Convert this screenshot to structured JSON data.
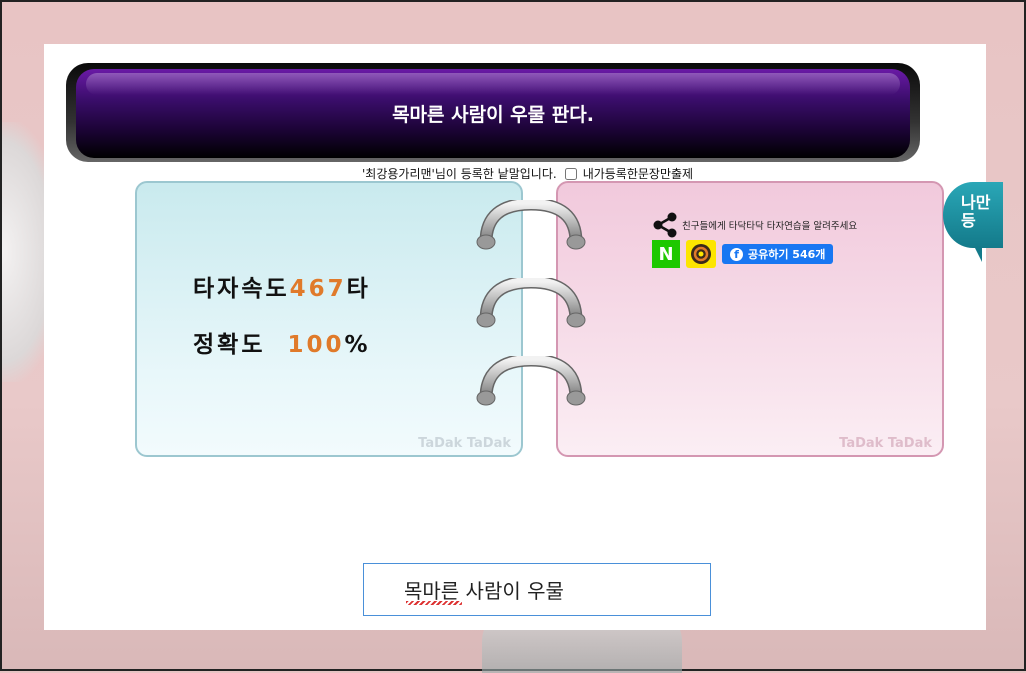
{
  "banner": {
    "title": "목마른 사람이 우물 판다."
  },
  "author_line": {
    "text": "'최강용가리맨'님이 등록한 낱말입니다.",
    "checkbox_label": "내가등록한문장만출제"
  },
  "stats": {
    "speed_label": "타자속도",
    "speed_value": "467",
    "speed_unit": "타",
    "accuracy_label": "정확도",
    "accuracy_value": "100",
    "accuracy_unit": "%"
  },
  "watermark": "TaDak TaDak",
  "share": {
    "text": "친구들에게 타닥타닥 타자연습을 알려주세요",
    "facebook_label": "공유하기 546개",
    "naver_label": "N"
  },
  "bubble": {
    "text": "나만 등"
  },
  "typing": {
    "value": "목마른 사람이 우물"
  },
  "colors": {
    "accent_orange": "#e07a2a",
    "banner_purple": "#3a0d6a"
  }
}
